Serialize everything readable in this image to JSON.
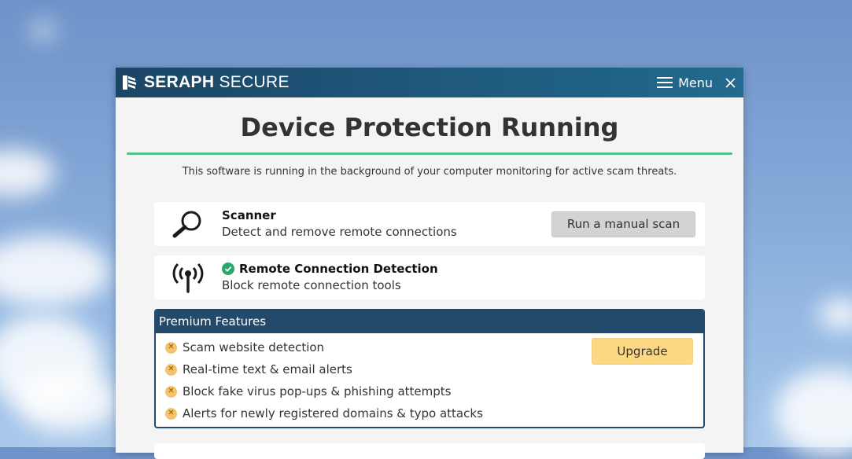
{
  "app": {
    "brand_bold": "SERAPH",
    "brand_light": "SECURE",
    "menu_label": "Menu"
  },
  "main": {
    "headline": "Device Protection Running",
    "subtitle": "This software is running in the background of your computer monitoring for active scam threats."
  },
  "scanner": {
    "title": "Scanner",
    "description": "Detect and remove remote connections",
    "button_label": "Run a manual scan",
    "icon": "magnifier-icon"
  },
  "remote": {
    "title": "Remote Connection Detection",
    "description": "Block remote connection tools",
    "icon": "broadcast-antenna-icon",
    "status_icon": "check-circle-icon"
  },
  "premium": {
    "header": "Premium Features",
    "upgrade_label": "Upgrade",
    "features": [
      {
        "label": "Scam website detection"
      },
      {
        "label": "Real-time text & email alerts"
      },
      {
        "label": "Block fake virus pop-ups & phishing attempts"
      },
      {
        "label": "Alerts for newly registered domains & typo attacks"
      }
    ]
  },
  "colors": {
    "titlebar": "#1f5a7e",
    "accent_green": "#52c08a",
    "premium_navy": "#234a6b",
    "upgrade_yellow": "#fdd883",
    "x_badge": "#f5c36b"
  }
}
